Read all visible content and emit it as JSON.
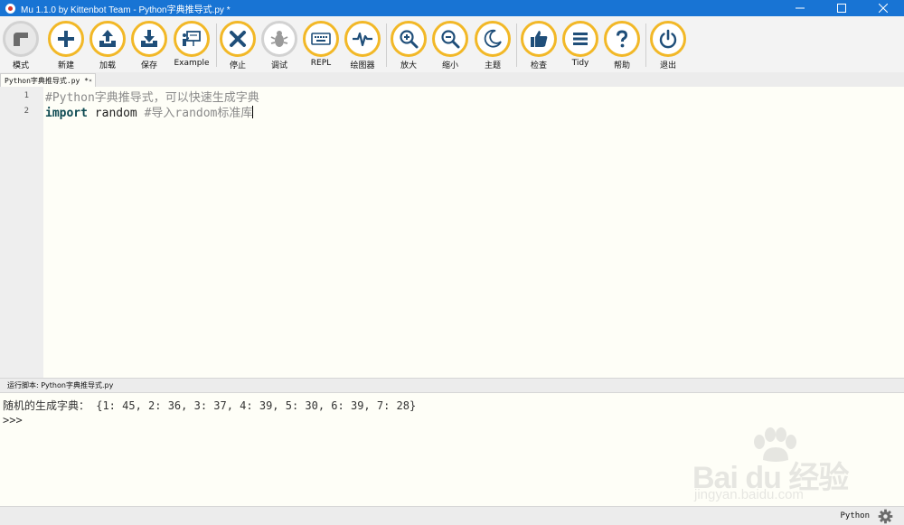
{
  "window": {
    "title": "Mu 1.1.0 by Kittenbot Team - Python字典推导式.py *",
    "controls": [
      "minimize",
      "maximize",
      "close"
    ]
  },
  "toolbar": {
    "buttons": [
      {
        "label": "模式",
        "icon": "mode-icon"
      },
      {
        "label": "新建",
        "icon": "plus-icon"
      },
      {
        "label": "加载",
        "icon": "upload-icon"
      },
      {
        "label": "保存",
        "icon": "download-icon"
      },
      {
        "label": "Example",
        "icon": "presentation-icon"
      },
      {
        "label": "停止",
        "icon": "close-x-icon"
      },
      {
        "label": "调试",
        "icon": "bug-icon",
        "disabled": true
      },
      {
        "label": "REPL",
        "icon": "keyboard-icon"
      },
      {
        "label": "绘图器",
        "icon": "pulse-icon"
      },
      {
        "label": "放大",
        "icon": "zoom-in-icon"
      },
      {
        "label": "缩小",
        "icon": "zoom-out-icon"
      },
      {
        "label": "主题",
        "icon": "moon-icon"
      },
      {
        "label": "检查",
        "icon": "thumbs-up-icon"
      },
      {
        "label": "Tidy",
        "icon": "lines-icon"
      },
      {
        "label": "帮助",
        "icon": "question-icon"
      },
      {
        "label": "退出",
        "icon": "power-icon"
      }
    ],
    "accent_color": "#f2b827",
    "icon_color": "#1f4e79"
  },
  "tab": {
    "label": "Python字典推导式.py *"
  },
  "editor": {
    "line_numbers": [
      "1",
      "2"
    ],
    "line1": "#Python字典推导式，可以快速生成字典",
    "line2_keyword": "import",
    "line2_ident": " random ",
    "line2_comment": "#导入random标准库"
  },
  "repl": {
    "header": "运行脚本: Python字典推导式.py",
    "output": "随机的生成字典： {1: 45, 2: 36, 3: 37, 4: 39, 5: 30, 6: 39, 7: 28}",
    "prompt": ">>>"
  },
  "watermark": {
    "brand": "Bai du 经验",
    "site": "jingyan.baidu.com"
  },
  "status": {
    "mode": "Python"
  }
}
